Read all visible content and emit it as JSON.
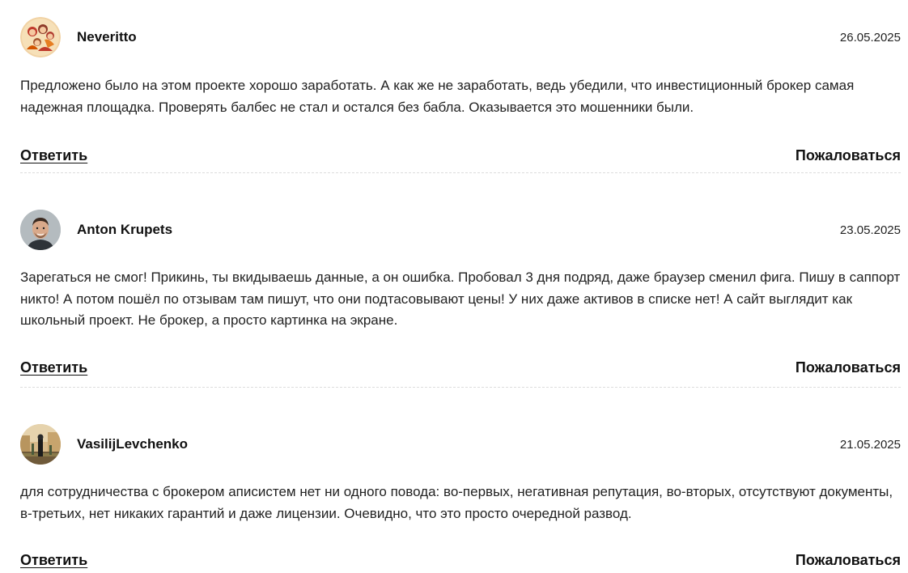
{
  "comments": [
    {
      "author": "Neveritto",
      "date": "26.05.2025",
      "avatar": "cartoon-family-avatar",
      "text": "Предложено было на этом проекте хорошо заработать. А как же не заработать, ведь убедили, что инвестиционный брокер самая надежная площадка. Проверять балбес не стал и остался без бабла. Оказывается это мошенники были.",
      "reply_label": "Ответить",
      "complain_label": "Пожаловаться"
    },
    {
      "author": "Anton Krupets",
      "date": "23.05.2025",
      "avatar": "man-portrait-avatar",
      "text": "Зарегаться не смог! Прикинь, ты вкидываешь данные, а он ошибка. Пробовал 3 дня подряд, даже браузер сменил фига. Пишу в саппорт никто! А потом пошёл по отзывам там пишут, что они подтасовывают цены! У них даже активов в списке нет! А сайт выглядит как школьный проект. Не брокер, а просто картинка на экране.",
      "reply_label": "Ответить",
      "complain_label": "Пожаловаться"
    },
    {
      "author": "VasilijLevchenko",
      "date": "21.05.2025",
      "avatar": "outdoor-person-photo-avatar",
      "text": "для сотрудничества с брокером аписистем нет ни одного повода: во-первых, негативная репутация, во-вторых, отсутствуют документы, в-третьих, нет никаких гарантий и даже лицензии. Очевидно, что это просто очередной развод.",
      "reply_label": "Ответить",
      "complain_label": "Пожаловаться"
    }
  ]
}
